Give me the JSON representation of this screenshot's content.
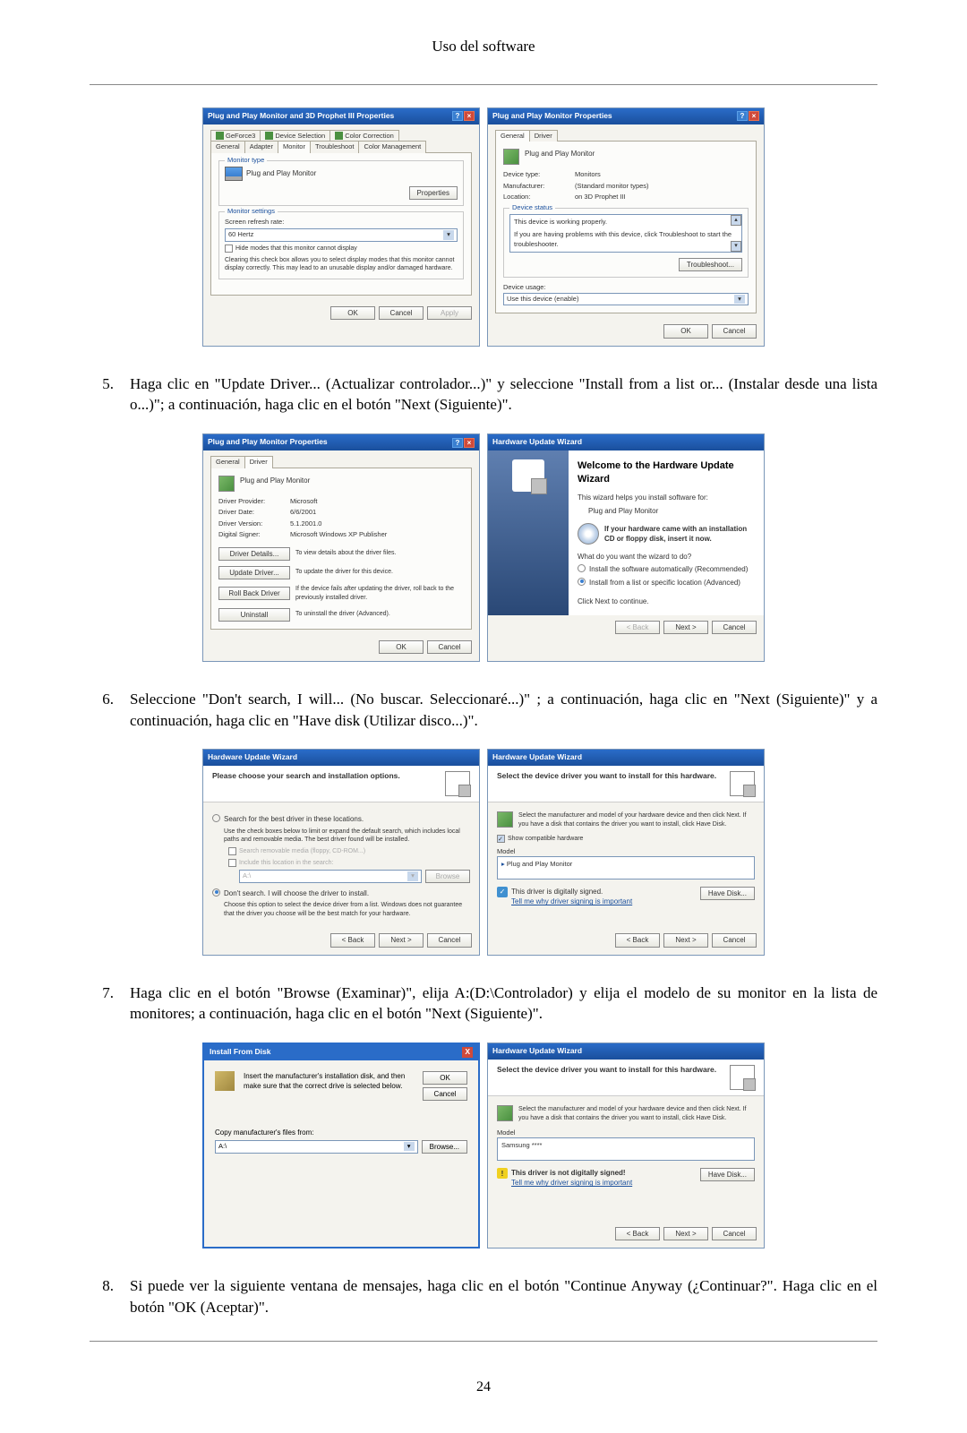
{
  "header_title": "Uso del software",
  "page_number": "24",
  "dlg1": {
    "title": "Plug and Play Monitor and 3D Prophet III Properties",
    "tabs_row1": [
      "GeForce3",
      "Device Selection",
      "Color Correction"
    ],
    "tabs_row2": [
      "General",
      "Adapter",
      "Monitor",
      "Troubleshoot",
      "Color Management"
    ],
    "monitor_type_label": "Monitor type",
    "monitor_type_value": "Plug and Play Monitor",
    "properties_btn": "Properties",
    "monitor_settings_label": "Monitor settings",
    "refresh_label": "Screen refresh rate:",
    "refresh_value": "60 Hertz",
    "hide_modes_label": "Hide modes that this monitor cannot display",
    "hide_modes_desc": "Clearing this check box allows you to select display modes that this monitor cannot display correctly. This may lead to an unusable display and/or damaged hardware.",
    "ok": "OK",
    "cancel": "Cancel",
    "apply": "Apply"
  },
  "dlg2": {
    "title": "Plug and Play Monitor Properties",
    "tab_general": "General",
    "tab_driver": "Driver",
    "header_text": "Plug and Play Monitor",
    "device_type_lbl": "Device type:",
    "device_type_val": "Monitors",
    "manufacturer_lbl": "Manufacturer:",
    "manufacturer_val": "(Standard monitor types)",
    "location_lbl": "Location:",
    "location_val": "on 3D Prophet III",
    "device_status_lbl": "Device status",
    "device_status_text": "This device is working properly.",
    "device_status_help": "If you are having problems with this device, click Troubleshoot to start the troubleshooter.",
    "troubleshoot_btn": "Troubleshoot...",
    "device_usage_lbl": "Device usage:",
    "device_usage_val": "Use this device (enable)",
    "ok": "OK",
    "cancel": "Cancel"
  },
  "step5": {
    "num": "5.",
    "text": "Haga clic en \"Update Driver... (Actualizar controlador...)\" y seleccione \"Install from a list or... (Instalar desde una lista o...)\"; a continuación, haga clic en el botón \"Next (Siguiente)\"."
  },
  "dlg3": {
    "title": "Plug and Play Monitor Properties",
    "tab_general": "General",
    "tab_driver": "Driver",
    "header_text": "Plug and Play Monitor",
    "provider_lbl": "Driver Provider:",
    "provider_val": "Microsoft",
    "date_lbl": "Driver Date:",
    "date_val": "6/6/2001",
    "version_lbl": "Driver Version:",
    "version_val": "5.1.2001.0",
    "signer_lbl": "Digital Signer:",
    "signer_val": "Microsoft Windows XP Publisher",
    "details_btn": "Driver Details...",
    "details_desc": "To view details about the driver files.",
    "update_btn": "Update Driver...",
    "update_desc": "To update the driver for this device.",
    "rollback_btn": "Roll Back Driver",
    "rollback_desc": "If the device fails after updating the driver, roll back to the previously installed driver.",
    "uninstall_btn": "Uninstall",
    "uninstall_desc": "To uninstall the driver (Advanced).",
    "ok": "OK",
    "cancel": "Cancel"
  },
  "dlg4": {
    "title": "Hardware Update Wizard",
    "welcome": "Welcome to the Hardware Update Wizard",
    "intro": "This wizard helps you install software for:",
    "device": "Plug and Play Monitor",
    "cd_hint": "If your hardware came with an installation CD or floppy disk, insert it now.",
    "question": "What do you want the wizard to do?",
    "radio1": "Install the software automatically (Recommended)",
    "radio2": "Install from a list or specific location (Advanced)",
    "continue_hint": "Click Next to continue.",
    "back": "< Back",
    "next": "Next >",
    "cancel": "Cancel"
  },
  "step6": {
    "num": "6.",
    "text": "Seleccione \"Don't search, I will... (No buscar. Seleccionaré...)\" ; a continuación, haga clic en \"Next (Siguiente)\" y a continuación, haga clic en \"Have disk (Utilizar disco...)\"."
  },
  "dlg5": {
    "title": "Hardware Update Wizard",
    "header": "Please choose your search and installation options.",
    "radio1": "Search for the best driver in these locations.",
    "radio1_desc": "Use the check boxes below to limit or expand the default search, which includes local paths and removable media. The best driver found will be installed.",
    "check1": "Search removable media (floppy, CD-ROM...)",
    "check2": "Include this location in the search:",
    "path_value": "A:\\",
    "browse_btn": "Browse",
    "radio2": "Don't search. I will choose the driver to install.",
    "radio2_desc": "Choose this option to select the device driver from a list. Windows does not guarantee that the driver you choose will be the best match for your hardware.",
    "back": "< Back",
    "next": "Next >",
    "cancel": "Cancel"
  },
  "dlg6": {
    "title": "Hardware Update Wizard",
    "header": "Select the device driver you want to install for this hardware.",
    "instruction": "Select the manufacturer and model of your hardware device and then click Next. If you have a disk that contains the driver you want to install, click Have Disk.",
    "show_compat": "Show compatible hardware",
    "model_lbl": "Model",
    "model_item": "Plug and Play Monitor",
    "signed_text": "This driver is digitally signed.",
    "signed_link": "Tell me why driver signing is important",
    "have_disk": "Have Disk...",
    "back": "< Back",
    "next": "Next >",
    "cancel": "Cancel"
  },
  "step7": {
    "num": "7.",
    "text": "Haga clic en el botón \"Browse (Examinar)\", elija A:(D:\\Controlador) y elija el modelo de su monitor en la lista de monitores; a continuación, haga clic en el botón \"Next (Siguiente)\"."
  },
  "dlg7": {
    "title": "Install From Disk",
    "close": "X",
    "instruction": "Insert the manufacturer's installation disk, and then make sure that the correct drive is selected below.",
    "ok": "OK",
    "cancel": "Cancel",
    "copy_from_lbl": "Copy manufacturer's files from:",
    "path_value": "A:\\",
    "browse": "Browse..."
  },
  "dlg8": {
    "title": "Hardware Update Wizard",
    "header": "Select the device driver you want to install for this hardware.",
    "instruction": "Select the manufacturer and model of your hardware device and then click Next. If you have a disk that contains the driver you want to install, click Have Disk.",
    "model_lbl": "Model",
    "model_item": "Samsung ****",
    "warn_text": "This driver is not digitally signed!",
    "warn_link": "Tell me why driver signing is important",
    "have_disk": "Have Disk...",
    "back": "< Back",
    "next": "Next >",
    "cancel": "Cancel"
  },
  "step8": {
    "num": "8.",
    "text": "Si puede ver la siguiente ventana de mensajes, haga clic en el botón \"Continue Anyway (¿Continuar?\". Haga clic en el botón \"OK (Aceptar)\"."
  }
}
